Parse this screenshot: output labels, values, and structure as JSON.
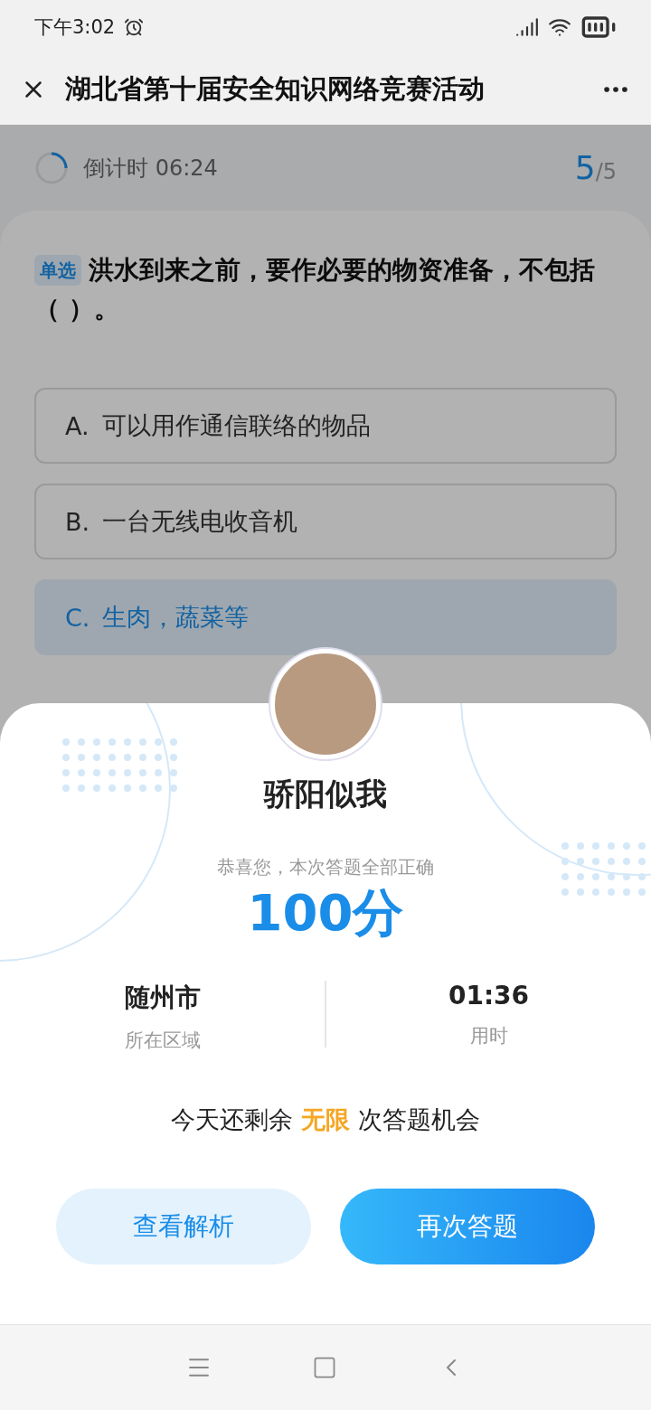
{
  "status_bar": {
    "time": "下午3:02"
  },
  "title_bar": {
    "title": "湖北省第十届安全知识网络竞赛活动"
  },
  "quiz": {
    "countdown": "倒计时 06:24",
    "progress_current": "5",
    "progress_total": "/5",
    "question_tag": "单选",
    "question": "洪水到来之前，要作必要的物资准备，不包括（ ）。",
    "options": [
      {
        "letter": "A.",
        "text": "可以用作通信联络的物品",
        "selected": false
      },
      {
        "letter": "B.",
        "text": "一台无线电收音机",
        "selected": false
      },
      {
        "letter": "C.",
        "text": "生肉，蔬菜等",
        "selected": true
      }
    ]
  },
  "result": {
    "name": "骄阳似我",
    "message": "恭喜您，本次答题全部正确",
    "score": "100分",
    "stats": [
      {
        "value": "随州市",
        "label": "所在区域"
      },
      {
        "value": "01:36",
        "label": "用时"
      }
    ],
    "chances_prefix": "今天还剩余",
    "chances_count": "无限",
    "chances_suffix": "次答题机会",
    "buttons": [
      {
        "label": "查看解析",
        "kind": "secondary"
      },
      {
        "label": "再次答题",
        "kind": "primary"
      }
    ]
  }
}
